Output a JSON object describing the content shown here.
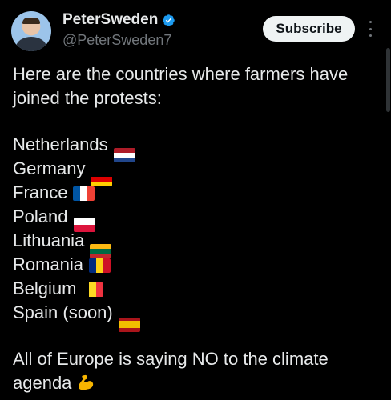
{
  "author": {
    "name": "PeterSweden",
    "handle": "@PeterSweden7",
    "verified": true
  },
  "actions": {
    "subscribe_label": "Subscribe",
    "more_icon": "more-vertical-icon"
  },
  "tweet": {
    "intro_line1": "Here are the countries where farmers have",
    "intro_line2": "joined the protests:",
    "countries": [
      {
        "name": "Netherlands",
        "flag_colors": [
          "#ae1c28",
          "#ffffff",
          "#21468b"
        ],
        "flag_dir": "horizontal"
      },
      {
        "name": "Germany",
        "flag_colors": [
          "#000000",
          "#dd0000",
          "#ffce00"
        ],
        "flag_dir": "horizontal"
      },
      {
        "name": "France",
        "flag_colors": [
          "#0055a4",
          "#ffffff",
          "#ef4135"
        ],
        "flag_dir": "vertical"
      },
      {
        "name": "Poland",
        "flag_colors": [
          "#ffffff",
          "#dc143c"
        ],
        "flag_dir": "horizontal"
      },
      {
        "name": "Lithuania",
        "flag_colors": [
          "#fdb913",
          "#006a44",
          "#c1272d"
        ],
        "flag_dir": "horizontal"
      },
      {
        "name": "Romania",
        "flag_colors": [
          "#002b7f",
          "#fcd116",
          "#ce1126"
        ],
        "flag_dir": "vertical"
      },
      {
        "name": "Belgium",
        "flag_colors": [
          "#000000",
          "#fdda24",
          "#ef3340"
        ],
        "flag_dir": "vertical"
      },
      {
        "name": "Spain (soon)",
        "flag_colors": [
          "#aa151b",
          "#f1bf00",
          "#f1bf00",
          "#aa151b"
        ],
        "flag_dir": "horizontal"
      }
    ],
    "closing_line1": "All of Europe is saying NO to the climate",
    "closing_line2": "agenda",
    "closing_emoji": "flexed-biceps-icon"
  },
  "colors": {
    "background": "#000000",
    "text": "#e7e9ea",
    "muted": "#71767b",
    "verified_blue": "#1d9bf0"
  }
}
